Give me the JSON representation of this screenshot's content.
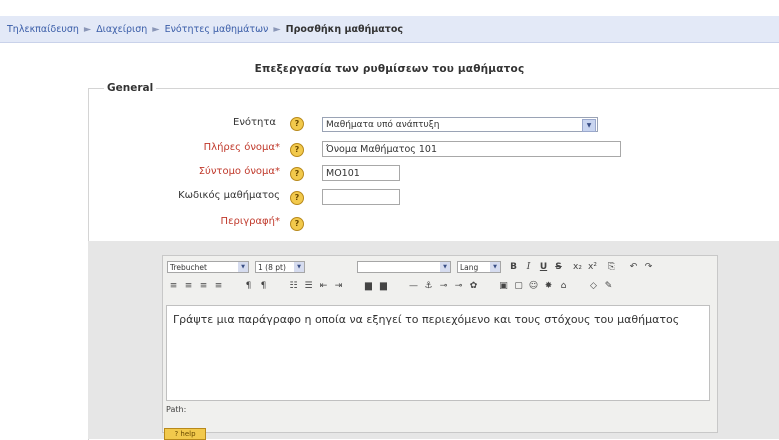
{
  "breadcrumb": {
    "items": [
      "Τηλεκπαίδευση",
      "Διαχείριση",
      "Ενότητες μαθημάτων"
    ],
    "current": "Προσθήκη μαθήματος",
    "separator": "►"
  },
  "page": {
    "heading": "Επεξεργασία των ρυθμίσεων του μαθήματος"
  },
  "form": {
    "legend": "General",
    "fields": {
      "category": {
        "label": "Ενότητα",
        "value": "Μαθήματα υπό ανάπτυξη",
        "required": false
      },
      "fullname": {
        "label": "Πλήρες όνομα",
        "value": "Όνομα Μαθήματος 101",
        "required": true
      },
      "shortname": {
        "label": "Σύντομο όνομα",
        "value": "ΜΟ101",
        "required": true
      },
      "idnumber": {
        "label": "Κωδικός μαθήματος",
        "value": "",
        "required": false
      },
      "summary": {
        "label": "Περιγραφή",
        "required": true
      }
    },
    "required_marker": "*",
    "help_glyph": "?"
  },
  "editor": {
    "font_family": "Trebuchet",
    "font_size": "1 (8 pt)",
    "format": "",
    "language": "Lang",
    "toolbar_row1": [
      "B",
      "I",
      "U",
      "S",
      "x₂",
      "x²",
      "⎘",
      "↶",
      "↷"
    ],
    "toolbar_row2": [
      "≡",
      "≡",
      "≡",
      "≡",
      "¶",
      "¶",
      "☷",
      "☰",
      "⇤",
      "⇥",
      "▆",
      "▆",
      "—",
      "⚓",
      "⊸",
      "⊸",
      "✿",
      "▣",
      "▢",
      "☺",
      "✸",
      "⌂",
      "◇",
      "✎"
    ],
    "content": "Γράψτε μια παράγραφο η οποία να εξηγεί το περιεχόμενο και τους στόχους του μαθήματος",
    "path_label": "Path:",
    "help_badge": "? help"
  },
  "colors": {
    "breadcrumb_bg": "#e3e9f7",
    "link": "#3a5da8",
    "required": "#c0392b",
    "help_icon": "#f2c94c"
  }
}
